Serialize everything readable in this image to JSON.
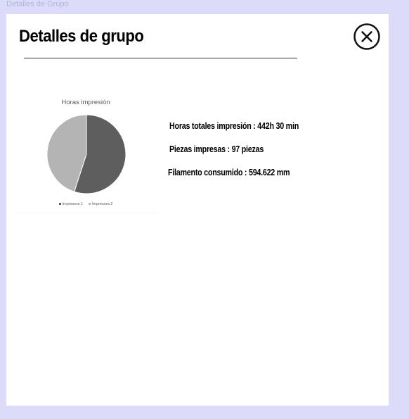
{
  "frame": {
    "label": "Detalles de Grupo"
  },
  "dialog": {
    "title": "Detalles de grupo",
    "close_icon": "close-circle-icon"
  },
  "stats": {
    "hours": "Horas totales impresión : 442h 30 min",
    "pieces": "Piezas impresas : 97 piezas",
    "filament": "Filamento consumido : 594.622 mm"
  },
  "chart_data": {
    "type": "pie",
    "title": "Horas impresión",
    "categories": [
      "Impresora 1",
      "Impresora 2"
    ],
    "values": [
      55,
      45
    ],
    "colors": [
      "#5e5e5e",
      "#b4b4b4"
    ],
    "legend_position": "bottom"
  }
}
